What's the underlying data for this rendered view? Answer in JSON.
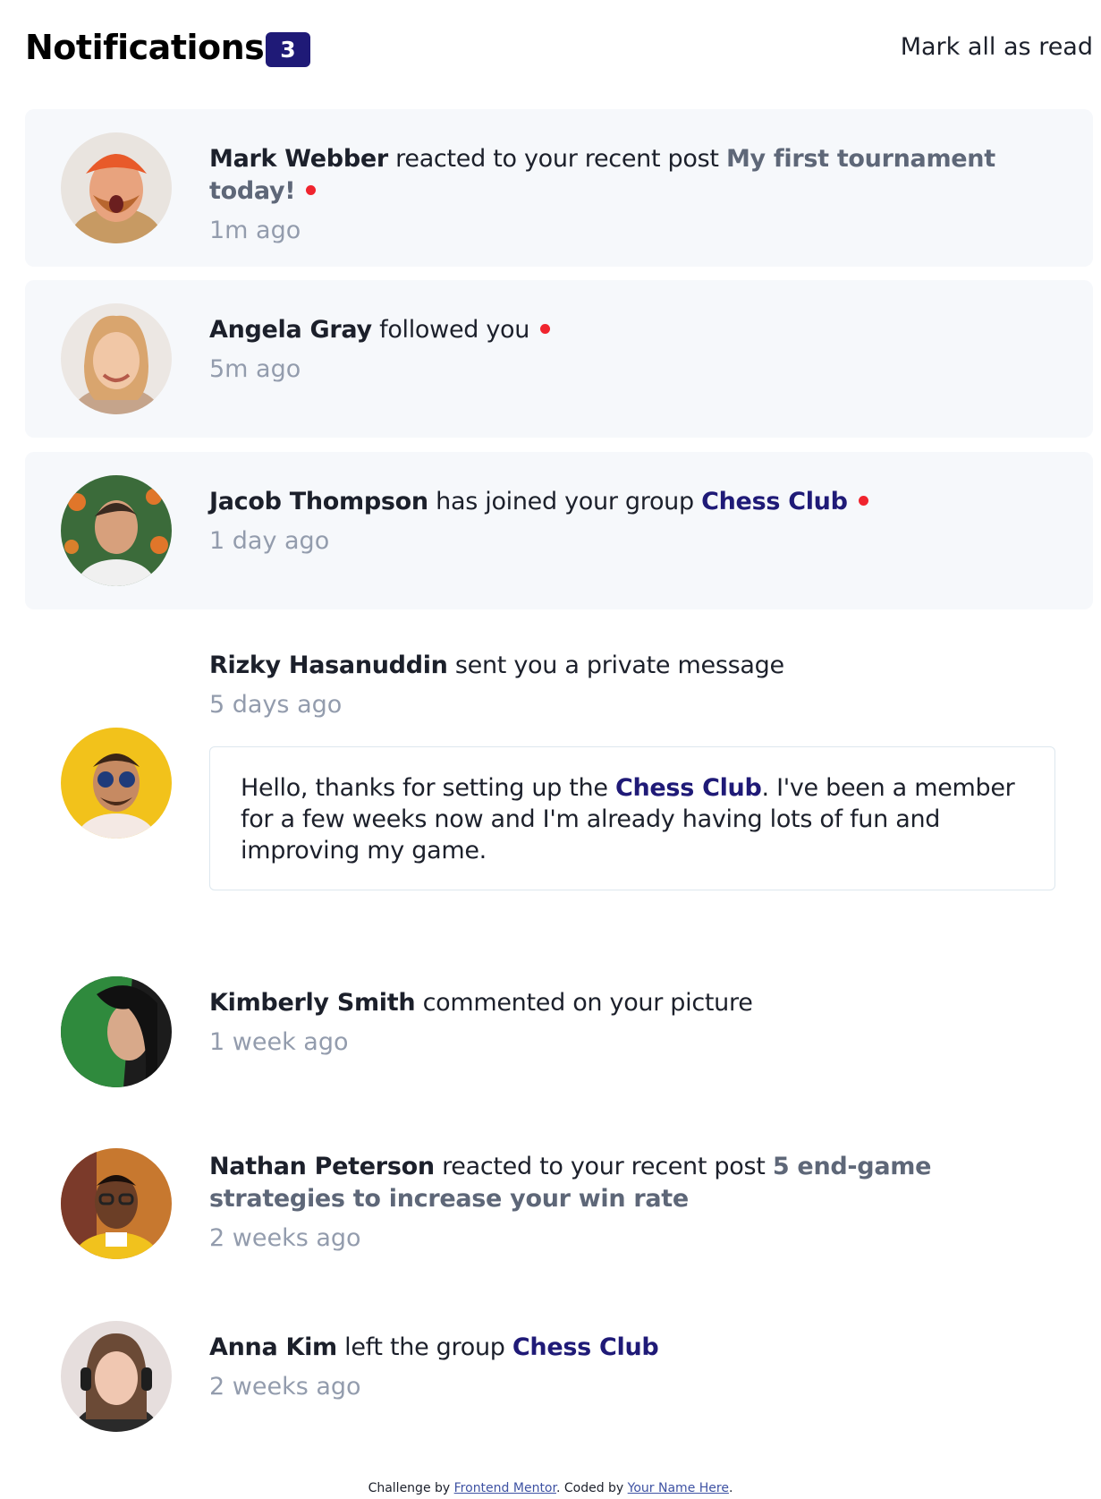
{
  "header": {
    "title": "Notifications",
    "unread_count": "3",
    "mark_all_label": "Mark all as read"
  },
  "colors": {
    "unread_bg": "#f6f8fb",
    "badge": "#1f1a77",
    "group_link": "#1f1a77",
    "unread_dot": "#f0242e",
    "time": "#939cad"
  },
  "notifications": [
    {
      "name": "Mark Webber",
      "action": "reacted to your recent post",
      "target": "My first tournament today!",
      "time": "1m ago",
      "unread": true,
      "avatar_icon": "avatar-mark-webber"
    },
    {
      "name": "Angela Gray",
      "action": "followed you",
      "time": "5m ago",
      "unread": true,
      "avatar_icon": "avatar-angela-gray"
    },
    {
      "name": "Jacob Thompson",
      "action": "has joined your group",
      "target": "Chess Club",
      "time": "1 day ago",
      "unread": true,
      "avatar_icon": "avatar-jacob-thompson"
    },
    {
      "name": "Rizky Hasanuddin",
      "action": "sent you a private message",
      "time": "5 days ago",
      "unread": false,
      "avatar_icon": "avatar-rizky-hasanuddin",
      "message_before": "Hello, thanks for setting up the",
      "message_link": "Chess Club",
      "message_after": ". I've been a member for a few weeks now and I'm already having lots of fun and improving my game."
    },
    {
      "name": "Kimberly Smith",
      "action": "commented on your picture",
      "time": "1 week ago",
      "unread": false,
      "avatar_icon": "avatar-kimberly-smith"
    },
    {
      "name": "Nathan Peterson",
      "action": "reacted to your recent post",
      "target": "5 end-game strategies to increase your win rate",
      "time": "2 weeks ago",
      "unread": false,
      "avatar_icon": "avatar-nathan-peterson"
    },
    {
      "name": "Anna Kim",
      "action": "left the group",
      "target": "Chess Club",
      "time": "2 weeks ago",
      "unread": false,
      "avatar_icon": "avatar-anna-kim"
    }
  ],
  "footer": {
    "challenge_by": "Challenge by",
    "frontend_mentor": "Frontend Mentor",
    "coded_by": ". Coded by",
    "your_name": "Your Name Here",
    "end": "."
  }
}
